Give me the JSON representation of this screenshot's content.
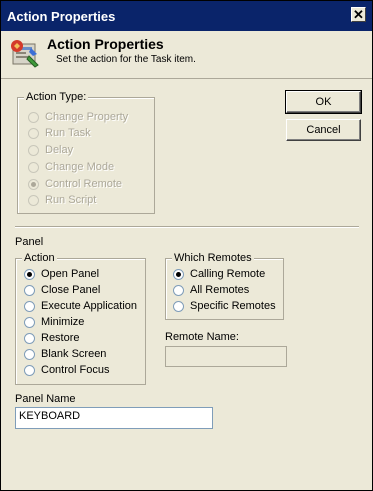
{
  "window": {
    "title": "Action Properties",
    "close_glyph": "✕"
  },
  "header": {
    "title": "Action Properties",
    "subtitle": "Set the action for the Task item.",
    "icon": "task-action-icon"
  },
  "buttons": {
    "ok": "OK",
    "cancel": "Cancel"
  },
  "action_type": {
    "legend": "Action Type:",
    "options": [
      "Change Property",
      "Run Task",
      "Delay",
      "Change Mode",
      "Control Remote",
      "Run Script"
    ],
    "selected": "Control Remote",
    "disabled": true
  },
  "panel_section": {
    "title": "Panel"
  },
  "action": {
    "legend": "Action",
    "options": [
      "Open Panel",
      "Close Panel",
      "Execute Application",
      "Minimize",
      "Restore",
      "Blank Screen",
      "Control Focus"
    ],
    "selected": "Open Panel"
  },
  "which_remotes": {
    "legend": "Which Remotes",
    "options": [
      "Calling Remote",
      "All Remotes",
      "Specific Remotes"
    ],
    "selected": "Calling Remote"
  },
  "remote_name": {
    "label": "Remote Name:",
    "value": ""
  },
  "panel_name": {
    "label": "Panel Name",
    "value": "KEYBOARD"
  }
}
